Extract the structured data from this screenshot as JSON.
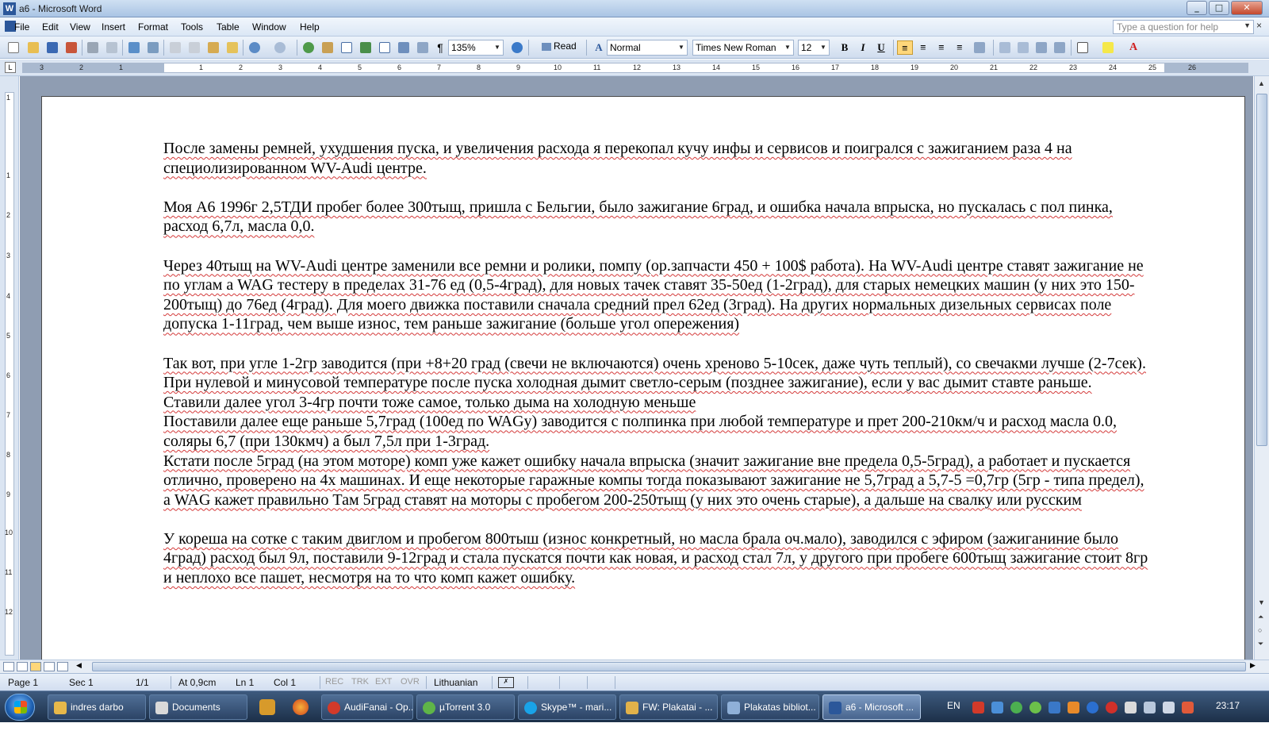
{
  "window": {
    "title": "a6 - Microsoft Word",
    "btn_min": "_",
    "btn_max": "□",
    "btn_close": "✕"
  },
  "menu": {
    "items": [
      "File",
      "Edit",
      "View",
      "Insert",
      "Format",
      "Tools",
      "Table",
      "Window",
      "Help"
    ],
    "help_placeholder": "Type a question for help",
    "close_doc": "×"
  },
  "toolbar": {
    "zoom": "135%",
    "read_label": "Read",
    "style": "Normal",
    "font": "Times New Roman",
    "size": "12",
    "bold": "B",
    "italic": "I",
    "underline": "U"
  },
  "ruler": {
    "numbers": [
      "3",
      "2",
      "1",
      "1",
      "2",
      "3",
      "4",
      "5",
      "6",
      "7",
      "8",
      "9",
      "10",
      "11",
      "12",
      "13",
      "14",
      "15",
      "16",
      "17",
      "18",
      "19",
      "20",
      "21",
      "22",
      "23",
      "24",
      "25",
      "26"
    ],
    "vnumbers": [
      "1",
      "1",
      "2",
      "3",
      "4",
      "5",
      "6",
      "7",
      "8",
      "9",
      "10",
      "11",
      "12"
    ]
  },
  "document": {
    "paragraphs": [
      "После замены ремней, ухудшения пуска, и увеличения расхода я перекопал кучу инфы и сервисов и поигрался с зажиганием раза 4 на специолизированном WV-Audi центре.",
      "",
      "Моя А6 1996г 2,5ТДИ пробег более 300тыщ, пришла с Бельгии, было зажигание 6град, и ошибка начала впрыска, но пускалась с пол пинка, расход 6,7л, масла 0,0.",
      "",
      "Через 40тыщ на WV-Audi центре заменили все ремни и ролики, помпу (ор.запчасти 450 + 100$ работа). На WV-Audi центре ставят зажигание не по углам а WAG тестеру в пределах 31-76 ед (0,5-4град), для новых тачек ставят 35-50ед (1-2град), для старых немецких машин (у них это 150-200тыщ) до 76ед (4град). Для моего движка поставили сначала средний прел 62ед (3град). На других нормальных дизельных сервисах поле допуска 1-11град, чем выше износ, тем раньше зажигание (больше угол опережения)",
      "",
      "Так вот, при угле 1-2гр заводится (при +8+20 град (свечи не включаются) очень хреново 5-10сек, даже чуть теплый), со свечакми лучше (2-7сек). При нулевой и минусовой температуре после пуска холодная дымит светло-серым (позднее зажигание), если у вас дымит ставте раньше.",
      "Ставили далее угол 3-4гр почти тоже самое, только дыма на холодную меньше",
      "Поставили далее еще раньше 5,7град (100ед по WAGу) заводится с полпинка при любой температуре и прет 200-210км/ч и расход масла 0.0, соляры 6,7 (при 130кмч) а был 7,5л при 1-3град.",
      "Кстати после 5град (на этом моторе) комп уже кажет ошибку начала впрыска (значит зажигание вне предела 0,5-5град), а работает и пускается отлично, проверено на 4х машинах. И еще некоторые гаражные компы тогда показывают зажигание не 5,7град а 5,7-5 =0,7гр (5гр - типа предел), а WAG кажет правильно Там 5град ставят на моторы с пробегом 200-250тыщ (у них это очень старые), а дальше на свалку или русским",
      "",
      "У кореша на сотке с таким двиглом и пробегом 800тыш (износ конкретный, но масла брала оч.мало), заводился с эфиром (зажиганиние было 4град) расход был 9л, поставили 9-12град и стала пускатся почти как новая, и расход стал 7л, у другого при пробеге 600тыщ зажигание стоит 8гр и неплохо все пашет, несмотря на то что комп кажет ошибку."
    ]
  },
  "status": {
    "page": "Page 1",
    "sec": "Sec 1",
    "pages": "1/1",
    "at": "At 0,9cm",
    "ln": "Ln 1",
    "col": "Col 1",
    "rec": "REC",
    "trk": "TRK",
    "ext": "EXT",
    "ovr": "OVR",
    "lang": "Lithuanian"
  },
  "taskbar": {
    "tasks": [
      {
        "label": "indres darbo",
        "color": "#e7b84a"
      },
      {
        "label": "Documents",
        "color": "#d9d9d9"
      },
      {
        "label": "AudiFanai - Op...",
        "color": "#d23a2a"
      },
      {
        "label": "µTorrent 3.0",
        "color": "#5fb548"
      },
      {
        "label": "Skype™ - mari...",
        "color": "#19a3e8"
      },
      {
        "label": "FW: Plakatai - ...",
        "color": "#e2b24a"
      },
      {
        "label": "Plakatas bibliot...",
        "color": "#8fb0d8"
      },
      {
        "label": "a6 - Microsoft ...",
        "color": "#2b579a"
      }
    ],
    "lang": "EN",
    "clock": "23:17"
  },
  "colors": {
    "accent": "#2b579a",
    "spell_underline": "#d43a3a",
    "workspace": "#8f9db2"
  }
}
